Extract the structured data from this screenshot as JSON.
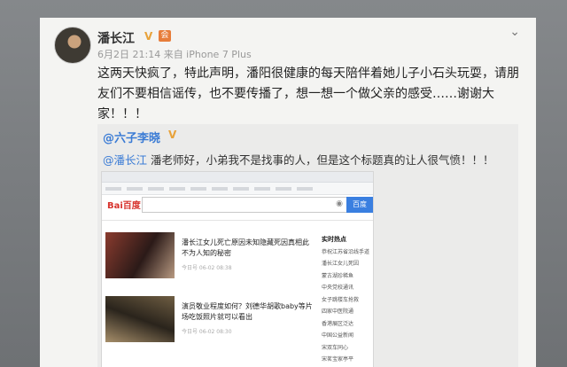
{
  "author": {
    "name": "潘长江",
    "verified_mark": "V",
    "member_mark": "会",
    "meta": "6月2日 21:14 来自 iPhone 7 Plus"
  },
  "post_text": "这两天快疯了，特此声明，潘阳很健康的每天陪伴着她儿子小石头玩耍，请朋友们不要相信谣传，也不要传播了，想一想一个做父亲的感受……谢谢大家！！！",
  "repost": {
    "user": "@六子李晓",
    "verified_mark": "V",
    "mention": "@潘长江",
    "text": " 潘老师好，小弟我不是找事的人，但是这个标题真的让人很气愤！！！",
    "screenshot": {
      "logo": "Bai百度",
      "search_button": "百度",
      "news": [
        {
          "title": "潘长江女儿死亡原因未知隐藏死因真相此不为人知的秘密",
          "sub": "今日号  06-02 08:38"
        },
        {
          "title": "演员敬业程度如何？刘德华胡歌baby等片场吃饭照片就可以看出",
          "sub": "今日号  06-02 08:30"
        }
      ],
      "side_heading": "实时热点",
      "side_items": [
        "恭祝江苏省沿线手道",
        "潘长江女儿死因",
        "蒙古湖珍稀鱼",
        "中央党校通讯",
        "女子跳楼车抢救",
        "四家中医院通",
        "香港展区泛达",
        "中国公益新闻",
        "宋双车同心",
        "宋茗宝家亭平"
      ]
    }
  },
  "colors": {
    "page_bg": "#7b7e81",
    "card_bg": "#f4f4f2",
    "repost_bg": "#ebebea",
    "link": "#3a7bd5",
    "verified": "#e8a23a"
  },
  "icons": {
    "menu": "chevron-down-icon",
    "search": "search-icon"
  }
}
